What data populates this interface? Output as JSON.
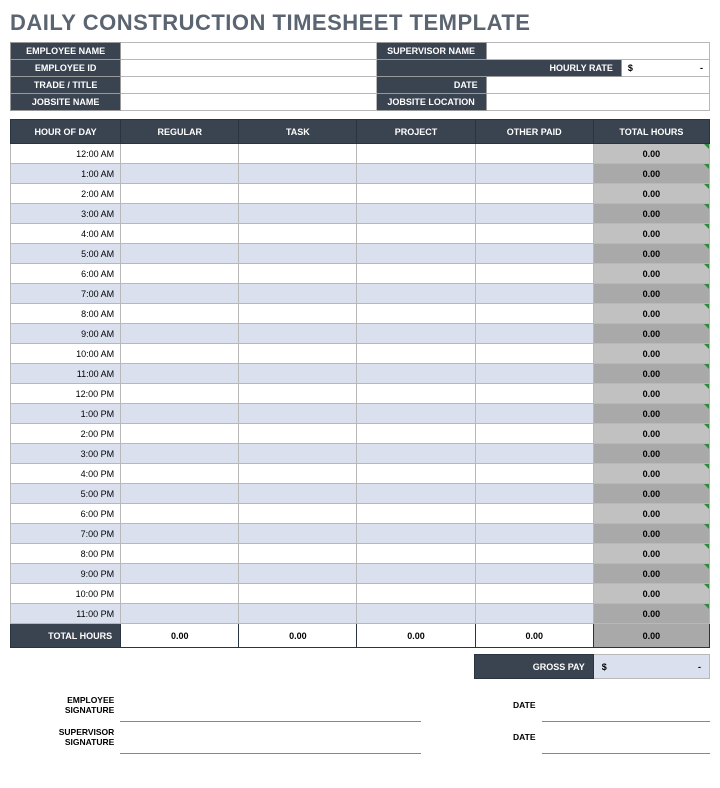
{
  "title": "DAILY CONSTRUCTION TIMESHEET TEMPLATE",
  "info": {
    "employee_name_label": "EMPLOYEE NAME",
    "employee_name": "",
    "supervisor_name_label": "SUPERVISOR NAME",
    "supervisor_name": "",
    "employee_id_label": "EMPLOYEE ID",
    "employee_id": "",
    "hourly_rate_label": "HOURLY RATE",
    "hourly_rate_prefix": "$",
    "hourly_rate_value": "-",
    "trade_title_label": "TRADE / TITLE",
    "trade_title": "",
    "date_label": "DATE",
    "date": "",
    "jobsite_name_label": "JOBSITE NAME",
    "jobsite_name": "",
    "jobsite_location_label": "JOBSITE LOCATION",
    "jobsite_location": ""
  },
  "columns": {
    "hour": "HOUR OF DAY",
    "regular": "REGULAR",
    "task": "TASK",
    "project": "PROJECT",
    "other": "OTHER PAID",
    "total": "TOTAL HOURS"
  },
  "hours": [
    {
      "label": "12:00 AM",
      "regular": "",
      "task": "",
      "project": "",
      "other": "",
      "total": "0.00"
    },
    {
      "label": "1:00 AM",
      "regular": "",
      "task": "",
      "project": "",
      "other": "",
      "total": "0.00"
    },
    {
      "label": "2:00 AM",
      "regular": "",
      "task": "",
      "project": "",
      "other": "",
      "total": "0.00"
    },
    {
      "label": "3:00 AM",
      "regular": "",
      "task": "",
      "project": "",
      "other": "",
      "total": "0.00"
    },
    {
      "label": "4:00 AM",
      "regular": "",
      "task": "",
      "project": "",
      "other": "",
      "total": "0.00"
    },
    {
      "label": "5:00 AM",
      "regular": "",
      "task": "",
      "project": "",
      "other": "",
      "total": "0.00"
    },
    {
      "label": "6:00 AM",
      "regular": "",
      "task": "",
      "project": "",
      "other": "",
      "total": "0.00"
    },
    {
      "label": "7:00 AM",
      "regular": "",
      "task": "",
      "project": "",
      "other": "",
      "total": "0.00"
    },
    {
      "label": "8:00 AM",
      "regular": "",
      "task": "",
      "project": "",
      "other": "",
      "total": "0.00"
    },
    {
      "label": "9:00 AM",
      "regular": "",
      "task": "",
      "project": "",
      "other": "",
      "total": "0.00"
    },
    {
      "label": "10:00 AM",
      "regular": "",
      "task": "",
      "project": "",
      "other": "",
      "total": "0.00"
    },
    {
      "label": "11:00 AM",
      "regular": "",
      "task": "",
      "project": "",
      "other": "",
      "total": "0.00"
    },
    {
      "label": "12:00 PM",
      "regular": "",
      "task": "",
      "project": "",
      "other": "",
      "total": "0.00"
    },
    {
      "label": "1:00 PM",
      "regular": "",
      "task": "",
      "project": "",
      "other": "",
      "total": "0.00"
    },
    {
      "label": "2:00 PM",
      "regular": "",
      "task": "",
      "project": "",
      "other": "",
      "total": "0.00"
    },
    {
      "label": "3:00 PM",
      "regular": "",
      "task": "",
      "project": "",
      "other": "",
      "total": "0.00"
    },
    {
      "label": "4:00 PM",
      "regular": "",
      "task": "",
      "project": "",
      "other": "",
      "total": "0.00"
    },
    {
      "label": "5:00 PM",
      "regular": "",
      "task": "",
      "project": "",
      "other": "",
      "total": "0.00"
    },
    {
      "label": "6:00 PM",
      "regular": "",
      "task": "",
      "project": "",
      "other": "",
      "total": "0.00"
    },
    {
      "label": "7:00 PM",
      "regular": "",
      "task": "",
      "project": "",
      "other": "",
      "total": "0.00"
    },
    {
      "label": "8:00 PM",
      "regular": "",
      "task": "",
      "project": "",
      "other": "",
      "total": "0.00"
    },
    {
      "label": "9:00 PM",
      "regular": "",
      "task": "",
      "project": "",
      "other": "",
      "total": "0.00"
    },
    {
      "label": "10:00 PM",
      "regular": "",
      "task": "",
      "project": "",
      "other": "",
      "total": "0.00"
    },
    {
      "label": "11:00 PM",
      "regular": "",
      "task": "",
      "project": "",
      "other": "",
      "total": "0.00"
    }
  ],
  "totals": {
    "label": "TOTAL HOURS",
    "regular": "0.00",
    "task": "0.00",
    "project": "0.00",
    "other": "0.00",
    "grand": "0.00"
  },
  "gross": {
    "label": "GROSS PAY",
    "prefix": "$",
    "value": "-"
  },
  "signatures": {
    "employee_label": "EMPLOYEE SIGNATURE",
    "supervisor_label": "SUPERVISOR SIGNATURE",
    "date_label": "DATE"
  }
}
